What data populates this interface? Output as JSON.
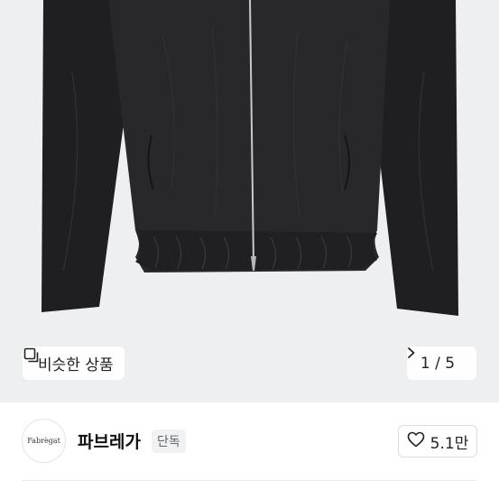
{
  "gallery": {
    "similar_label": "비슷한 상품",
    "counter": "1 / 5",
    "icons": {
      "similar": "copy-icon",
      "next": "chevron-right-icon"
    }
  },
  "shop": {
    "logo_text": "Fabrègat",
    "name": "파브레가",
    "badge": "단독",
    "like_count": "5.1만",
    "like_icon": "heart-icon"
  },
  "colors": {
    "hero_bg": "#eeeff1",
    "jacket": "#262628",
    "zipper": "#c9c9cb"
  }
}
